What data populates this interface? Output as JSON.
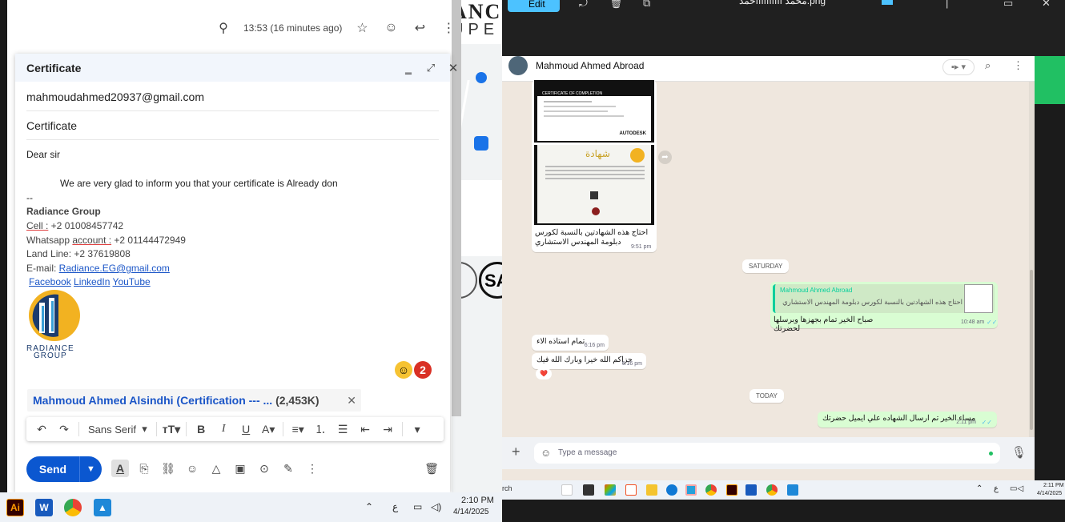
{
  "gmail": {
    "timestamp": "13:53 (16 minutes ago)",
    "compose": {
      "title": "Certificate",
      "to": "mahmoudahmed20937@gmail.com",
      "subject": "Certificate",
      "greeting": "Dear sir",
      "body": "We are very glad to inform you that your certificate is Already don",
      "sig_dash": "--",
      "sig_company": "Radiance Group",
      "sig_cell_label": "Cell :",
      "sig_cell": " +2 01008457742",
      "sig_whatsapp_label1": "Whatsapp ",
      "sig_whatsapp_label2": "account :",
      "sig_whatsapp": " +2 01144472949",
      "sig_landline": "Land Line: +2 37619808",
      "sig_email_label": "E-mail: ",
      "sig_email": "Radiance.EG@gmail.com",
      "sig_facebook": "Facebook",
      "sig_linkedin": "LinkedIn",
      "sig_youtube": "YouTube ",
      "logo_line1": "RADIANCE",
      "logo_line2": "GROUP",
      "notif_count": "2",
      "attachment_name": "Mahmoud Ahmed Alsindhi (Certification --- ...",
      "attachment_size": "(2,453K)",
      "font_select": "Sans Serif",
      "send_label": "Send"
    }
  },
  "taskbar_left": {
    "time": "2:10 PM",
    "date": "4/14/2025",
    "lang": "ع",
    "ai_label": "Ai"
  },
  "right_window": {
    "edit_label": "Edit",
    "title": "محمد ااااااااااحمد.png"
  },
  "whatsapp": {
    "contact": "Mahmoud Ahmed Abroad",
    "img_caption": "احتاج هذه الشهادتين بالنسبة لكورس دبلومة المهندس الاستشاري",
    "img_time": "9:51 pm",
    "cert_title": "CERTIFICATE OF COMPLETION",
    "cert_brand": "AUTODESK",
    "cert_arabic": "شهادة",
    "day1": "SATURDAY",
    "quote_name": "Mahmoud Ahmed Abroad",
    "quote_text": "احتاج هذه الشهادتين بالنسبة لكورس دبلومة المهندس الاستشاري",
    "out1_text": "صباح الخير تمام بجهزها وبرسلها لحضرتك",
    "out1_time": "10:48 am",
    "in1_text": "تمام استاذه الاء",
    "in1_time": "6:16 pm",
    "in2_text": "جزاكم الله خيرا وبارك الله فيك",
    "in2_time": "6:16 pm",
    "reaction": "❤️",
    "day2": "TODAY",
    "out2_text": "مساء الخير تم ارسال الشهاده علي ايميل حضرتك",
    "out2_time": "2:11 pm",
    "placeholder": "Type a message"
  },
  "taskbar_right": {
    "search": "rch",
    "time": "2:11 PM",
    "date": "4/14/2025",
    "lang": "ع"
  },
  "bg_map": {
    "letters_top": "ANCE",
    "letters_mid": "UPE",
    "circle_text": "SA"
  }
}
